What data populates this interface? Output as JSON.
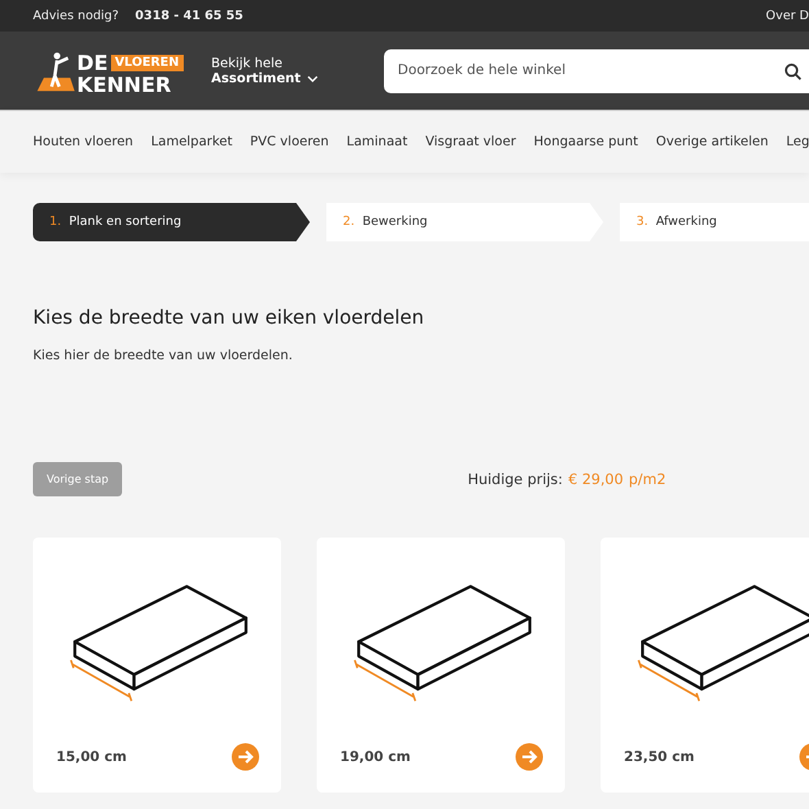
{
  "top_bar": {
    "help_label": "Advies nodig?",
    "phone": "0318 - 41 65 55",
    "right_link": "Over D"
  },
  "header": {
    "logo": {
      "word_de": "DE",
      "word_vloeren": "VLOEREN",
      "word_kenner": "KENNER"
    },
    "assortment": {
      "line_1": "Bekijk hele",
      "line_2": "Assortiment"
    },
    "search": {
      "placeholder": "Doorzoek de hele winkel"
    }
  },
  "nav": {
    "items": [
      "Houten vloeren",
      "Lamelparket",
      "PVC vloeren",
      "Laminaat",
      "Visgraat vloer",
      "Hongaarse punt",
      "Overige artikelen",
      "Leg"
    ]
  },
  "steps": [
    {
      "number": "1.",
      "label": "Plank en sortering",
      "selected": true
    },
    {
      "number": "2.",
      "label": "Bewerking",
      "selected": false
    },
    {
      "number": "3.",
      "label": "Afwerking",
      "selected": false
    }
  ],
  "heading": "Kies de breedte van uw eiken vloerdelen",
  "subtitle": "Kies hier de breedte van uw vloerdelen.",
  "prev_button": {
    "label": "Vorige stap",
    "disabled": true
  },
  "price": {
    "label": "Huidige prijs:",
    "value": "€ 29,00",
    "unit": "p/m2"
  },
  "options": [
    {
      "label": "15,00 cm"
    },
    {
      "label": "19,00 cm"
    },
    {
      "label": "23,50 cm"
    }
  ]
}
